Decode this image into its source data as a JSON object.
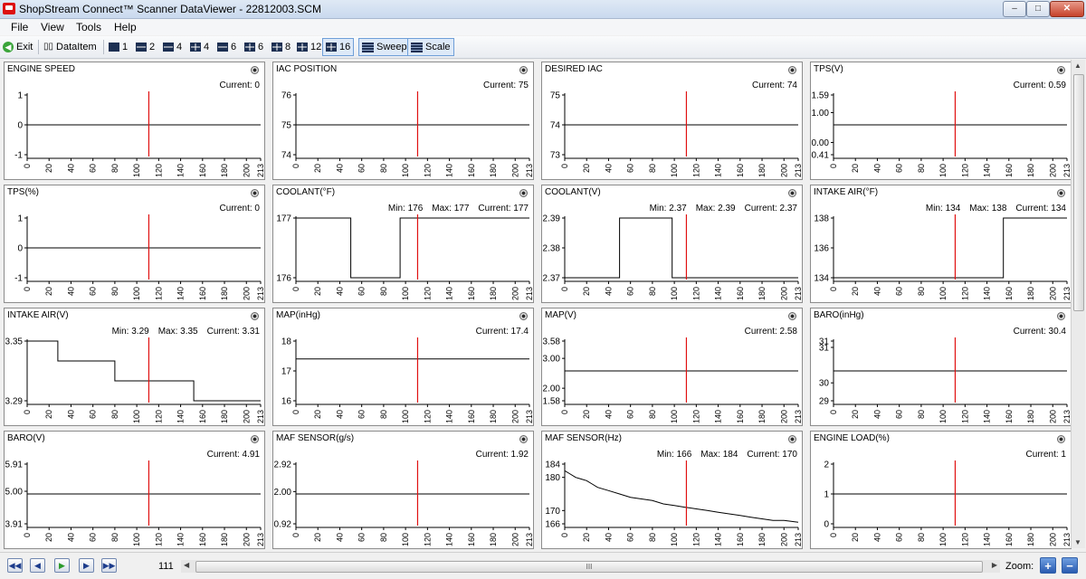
{
  "window": {
    "title": "ShopStream Connect™ Scanner DataViewer - 22812003.SCM",
    "minimize": "–",
    "restore": "□",
    "close": "✕"
  },
  "menu": [
    "File",
    "View",
    "Tools",
    "Help"
  ],
  "toolbar": {
    "exit": "Exit",
    "dataitem": "DataItem",
    "layouts": [
      "1",
      "2",
      "4",
      "4",
      "6",
      "6",
      "8",
      "12",
      "16"
    ],
    "sweep": "Sweep",
    "scale": "Scale"
  },
  "x_ticks": [
    "0",
    "20",
    "40",
    "60",
    "80",
    "100",
    "120",
    "140",
    "160",
    "180",
    "200",
    "213"
  ],
  "cursor_position": 111,
  "chart_data": [
    {
      "type": "line",
      "title": "ENGINE SPEED",
      "min": null,
      "max": null,
      "current": "0",
      "yticks": [
        "1",
        "0",
        "-1"
      ],
      "ylim": [
        -1,
        1
      ],
      "xlim": [
        0,
        213
      ],
      "x": [
        0,
        213
      ],
      "y": [
        0,
        0
      ]
    },
    {
      "type": "line",
      "title": "IAC POSITION",
      "min": null,
      "max": null,
      "current": "75",
      "yticks": [
        "76",
        "75",
        "74"
      ],
      "ylim": [
        74,
        76
      ],
      "xlim": [
        0,
        213
      ],
      "x": [
        0,
        213
      ],
      "y": [
        75,
        75
      ]
    },
    {
      "type": "line",
      "title": "DESIRED IAC",
      "min": null,
      "max": null,
      "current": "74",
      "yticks": [
        "75",
        "74",
        "73"
      ],
      "ylim": [
        73,
        75
      ],
      "xlim": [
        0,
        213
      ],
      "x": [
        0,
        213
      ],
      "y": [
        74,
        74
      ]
    },
    {
      "type": "line",
      "title": "TPS(V)",
      "min": null,
      "max": null,
      "current": "0.59",
      "yticks": [
        "1.59",
        "1.00",
        "0.00",
        "-0.41"
      ],
      "ylim": [
        -0.41,
        1.59
      ],
      "xlim": [
        0,
        213
      ],
      "x": [
        0,
        213
      ],
      "y": [
        0.59,
        0.59
      ]
    },
    {
      "type": "line",
      "title": "TPS(%)",
      "min": null,
      "max": null,
      "current": "0",
      "yticks": [
        "1",
        "0",
        "-1"
      ],
      "ylim": [
        -1,
        1
      ],
      "xlim": [
        0,
        213
      ],
      "x": [
        0,
        213
      ],
      "y": [
        0,
        0
      ]
    },
    {
      "type": "line",
      "title": "COOLANT(°F)",
      "min": "176",
      "max": "177",
      "current": "177",
      "yticks": [
        "177",
        "176"
      ],
      "ylim": [
        176,
        177
      ],
      "xlim": [
        0,
        213
      ],
      "x": [
        0,
        50,
        50,
        95,
        95,
        213
      ],
      "y": [
        177,
        177,
        176,
        176,
        177,
        177
      ]
    },
    {
      "type": "line",
      "title": "COOLANT(V)",
      "min": "2.37",
      "max": "2.39",
      "current": "2.37",
      "yticks": [
        "2.39",
        "2.38",
        "2.37"
      ],
      "ylim": [
        2.37,
        2.39
      ],
      "xlim": [
        0,
        213
      ],
      "x": [
        0,
        50,
        50,
        98,
        98,
        213
      ],
      "y": [
        2.37,
        2.37,
        2.39,
        2.39,
        2.37,
        2.37
      ]
    },
    {
      "type": "line",
      "title": "INTAKE AIR(°F)",
      "min": "134",
      "max": "138",
      "current": "134",
      "yticks": [
        "138",
        "136",
        "134"
      ],
      "ylim": [
        134,
        138
      ],
      "xlim": [
        0,
        213
      ],
      "x": [
        0,
        155,
        155,
        213
      ],
      "y": [
        134,
        134,
        138,
        138
      ]
    },
    {
      "type": "line",
      "title": "INTAKE AIR(V)",
      "min": "3.29",
      "max": "3.35",
      "current": "3.31",
      "yticks": [
        "3.35",
        "3.29"
      ],
      "ylim": [
        3.29,
        3.35
      ],
      "xlim": [
        0,
        213
      ],
      "x": [
        0,
        28,
        28,
        80,
        80,
        152,
        152,
        213
      ],
      "y": [
        3.35,
        3.35,
        3.33,
        3.33,
        3.31,
        3.31,
        3.29,
        3.29
      ]
    },
    {
      "type": "line",
      "title": "MAP(inHg)",
      "min": null,
      "max": null,
      "current": "17.4",
      "yticks": [
        "18",
        "17",
        "16"
      ],
      "ylim": [
        16,
        18
      ],
      "xlim": [
        0,
        213
      ],
      "x": [
        0,
        213
      ],
      "y": [
        17.4,
        17.4
      ]
    },
    {
      "type": "line",
      "title": "MAP(V)",
      "min": null,
      "max": null,
      "current": "2.58",
      "yticks": [
        "3.58",
        "3.00",
        "2.00",
        "1.58"
      ],
      "ylim": [
        1.58,
        3.58
      ],
      "xlim": [
        0,
        213
      ],
      "x": [
        0,
        213
      ],
      "y": [
        2.58,
        2.58
      ]
    },
    {
      "type": "line",
      "title": "BARO(inHg)",
      "min": null,
      "max": null,
      "current": "30.4",
      "yticks": [
        "31",
        "31",
        "30",
        "29"
      ],
      "ylim": [
        29.4,
        31.4
      ],
      "xlim": [
        0,
        213
      ],
      "x": [
        0,
        213
      ],
      "y": [
        30.4,
        30.4
      ]
    },
    {
      "type": "line",
      "title": "BARO(V)",
      "min": null,
      "max": null,
      "current": "4.91",
      "yticks": [
        "5.91",
        "5.00",
        "3.91"
      ],
      "ylim": [
        3.91,
        5.91
      ],
      "xlim": [
        0,
        213
      ],
      "x": [
        0,
        213
      ],
      "y": [
        4.91,
        4.91
      ]
    },
    {
      "type": "line",
      "title": "MAF SENSOR(g/s)",
      "min": null,
      "max": null,
      "current": "1.92",
      "yticks": [
        "2.92",
        "2.00",
        "0.92"
      ],
      "ylim": [
        0.92,
        2.92
      ],
      "xlim": [
        0,
        213
      ],
      "x": [
        0,
        213
      ],
      "y": [
        1.92,
        1.92
      ]
    },
    {
      "type": "line",
      "title": "MAF SENSOR(Hz)",
      "min": "166",
      "max": "184",
      "current": "170",
      "yticks": [
        "184",
        "180",
        "170",
        "166"
      ],
      "ylim": [
        166,
        184
      ],
      "xlim": [
        0,
        213
      ],
      "x": [
        0,
        5,
        10,
        15,
        20,
        25,
        30,
        40,
        50,
        60,
        70,
        80,
        90,
        100,
        110,
        120,
        130,
        140,
        150,
        160,
        170,
        180,
        190,
        200,
        213
      ],
      "y": [
        182,
        181,
        180,
        179.5,
        179,
        178,
        177,
        176,
        175,
        174,
        173.5,
        173,
        172,
        171.5,
        171,
        170.5,
        170,
        169.5,
        169,
        168.5,
        168,
        167.5,
        167,
        167,
        166.5
      ]
    },
    {
      "type": "line",
      "title": "ENGINE LOAD(%)",
      "min": null,
      "max": null,
      "current": "1",
      "yticks": [
        "2",
        "1",
        "0"
      ],
      "ylim": [
        0,
        2
      ],
      "xlim": [
        0,
        213
      ],
      "x": [
        0,
        213
      ],
      "y": [
        1,
        1
      ]
    }
  ],
  "stats_labels": {
    "min": "Min:",
    "max": "Max:",
    "current": "Current:"
  },
  "bottom": {
    "frame": "111",
    "zoom_label": "Zoom:",
    "scroll_grip": "III"
  }
}
